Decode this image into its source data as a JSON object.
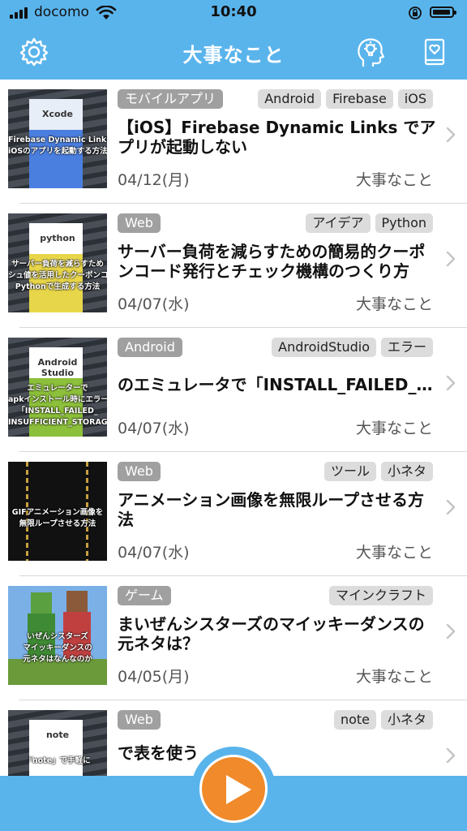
{
  "status_bar": {
    "carrier": "docomo",
    "time": "10:40"
  },
  "nav": {
    "title": "大事なこと",
    "left_icon": "gear-icon",
    "right_icons": [
      "head-lightbulb-icon",
      "bookmark-heart-icon"
    ]
  },
  "articles": [
    {
      "category": "モバイルアプリ",
      "tags": [
        "Android",
        "Firebase",
        "iOS"
      ],
      "title": "【iOS】Firebase Dynamic Links でアプリが起動しない",
      "date": "04/12(月)",
      "author": "大事なこと",
      "thumb": {
        "style": "xcode",
        "label": "Xcode",
        "lines": [
          "Firebase Dynamic Links で",
          "iOSのアプリを起動する方法"
        ]
      }
    },
    {
      "category": "Web",
      "tags": [
        "アイデア",
        "Python"
      ],
      "title": "サーバー負荷を減らすための簡易的クーポンコード発行とチェック機構のつくり方",
      "date": "04/07(水)",
      "author": "大事なこと",
      "thumb": {
        "style": "python",
        "label": "python",
        "lines": [
          "サーバー負荷を減らすため",
          "シュ値を活用したクーポンコ",
          "Pythonで生成する方法"
        ]
      }
    },
    {
      "category": "Android",
      "tags": [
        "AndroidStudio",
        "エラー"
      ],
      "title": "のエミュレータで「INSTALL_FAILED_INSUFFICIENT_ST…",
      "date": "04/07(水)",
      "author": "大事なこと",
      "thumb": {
        "style": "android",
        "label": "Android Studio",
        "lines": [
          "エミュレーターで",
          "apkインストール時にエラー",
          "「INSTALL_FAILED_",
          "INSUFFICIENT_STORAGE」"
        ]
      }
    },
    {
      "category": "Web",
      "tags": [
        "ツール",
        "小ネタ"
      ],
      "title": "アニメーション画像を無限ループさせる方法",
      "date": "04/07(水)",
      "author": "大事なこと",
      "thumb": {
        "style": "film",
        "label": "",
        "lines": [
          "GIFアニメーション画像を",
          "無限ループさせる方法"
        ]
      }
    },
    {
      "category": "ゲーム",
      "tags": [
        "マインクラフト"
      ],
      "title": "まいぜんシスターズのマイッキーダンスの元ネタは？",
      "date": "04/05(月)",
      "author": "大事なこと",
      "thumb": {
        "style": "minecraft",
        "label": "",
        "lines": [
          "いぜんシスターズ",
          "マイッキーダンスの",
          "元ネタはなんなのか"
        ]
      }
    },
    {
      "category": "Web",
      "tags": [
        "note",
        "小ネタ"
      ],
      "title": "で表を使う",
      "date": "",
      "author": "",
      "thumb": {
        "style": "note",
        "label": "note",
        "lines": [
          "「note」で手軽に"
        ]
      }
    }
  ],
  "bottom": {
    "play_icon": "play-icon"
  },
  "colors": {
    "bar": "#5ab4ec",
    "play": "#f08a2a",
    "category": "#a0a0a0",
    "tag": "#dcdcdc"
  }
}
